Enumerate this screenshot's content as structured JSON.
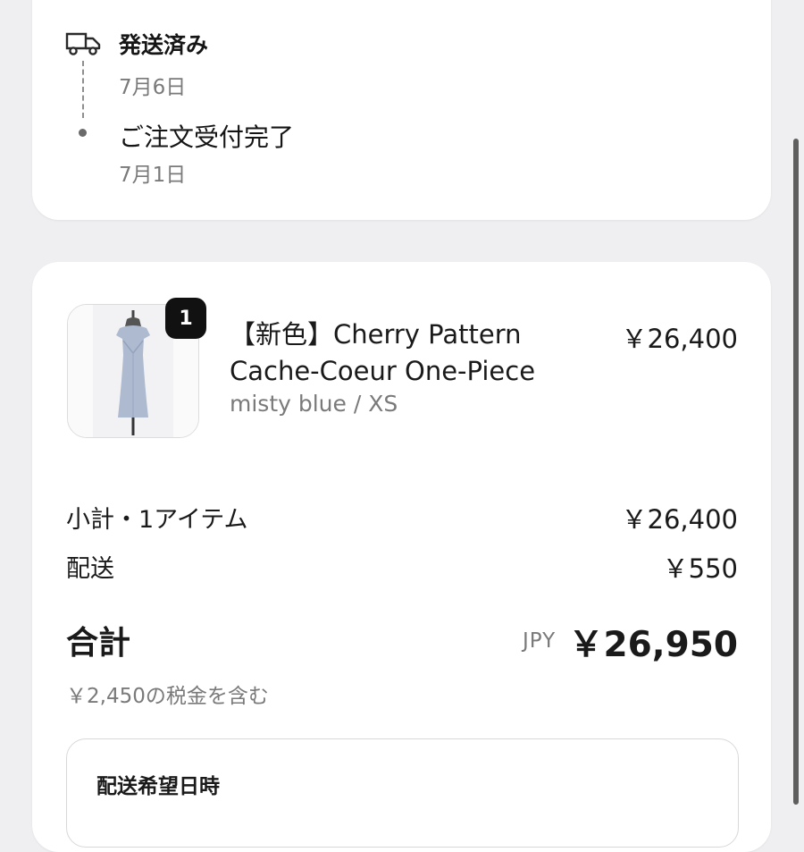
{
  "status": {
    "events": [
      {
        "title": "発送済み",
        "date": "7月6日"
      },
      {
        "title": "ご注文受付完了",
        "date": "7月1日"
      }
    ]
  },
  "order": {
    "item": {
      "quantity": "1",
      "name_line1": "【新色】Cherry Pattern",
      "name_line2": "Cache-Coeur One-Piece",
      "variant": "misty blue / XS",
      "price": "￥26,400"
    },
    "subtotal": {
      "label": "小計・1アイテム",
      "value": "￥26,400"
    },
    "shipping": {
      "label": "配送",
      "value": "￥550"
    },
    "total": {
      "label": "合計",
      "currency": "JPY",
      "value": "￥26,950"
    },
    "tax_note": "￥2,450の税金を含む",
    "delivery": {
      "title": "配送希望日時"
    }
  },
  "icons": {
    "status": "truck-icon",
    "timeline": "timeline-dot-icon"
  },
  "colors": {
    "background": "#efeff1",
    "card": "#ffffff",
    "badge": "#111111",
    "muted_text": "#7a7a7a"
  }
}
